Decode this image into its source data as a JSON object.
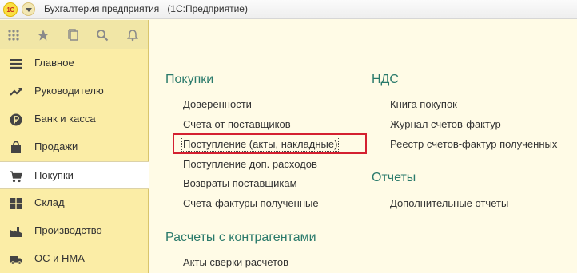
{
  "window": {
    "app_title": "Бухгалтерия предприятия",
    "platform_title": "(1С:Предприятие)",
    "logo_text": "1С"
  },
  "toolbar": {
    "icons": [
      "apps-grid-icon",
      "favorites-star-icon",
      "history-icon",
      "search-icon",
      "notifications-bell-icon"
    ]
  },
  "sidebar": {
    "items": [
      {
        "label": "Главное",
        "icon": "menu-lines-icon"
      },
      {
        "label": "Руководителю",
        "icon": "trend-icon"
      },
      {
        "label": "Банк и касса",
        "icon": "ruble-coin-icon"
      },
      {
        "label": "Продажи",
        "icon": "shopping-bag-icon"
      },
      {
        "label": "Покупки",
        "icon": "shopping-cart-icon",
        "active": true
      },
      {
        "label": "Склад",
        "icon": "warehouse-grid-icon"
      },
      {
        "label": "Производство",
        "icon": "factory-icon"
      },
      {
        "label": "ОС и НМА",
        "icon": "truck-icon"
      }
    ]
  },
  "main": {
    "sections": {
      "purchases": {
        "title": "Покупки",
        "links": [
          "Доверенности",
          "Счета от поставщиков",
          "Поступление (акты, накладные)",
          "Поступление доп. расходов",
          "Возвраты поставщикам",
          "Счета-фактуры полученные"
        ]
      },
      "vat": {
        "title": "НДС",
        "links": [
          "Книга покупок",
          "Журнал счетов-фактур",
          "Реестр счетов-фактур полученных"
        ]
      },
      "reports": {
        "title": "Отчеты",
        "links": [
          "Дополнительные отчеты"
        ]
      },
      "settlements": {
        "title": "Расчеты с контрагентами",
        "links": [
          "Акты сверки расчетов"
        ]
      }
    },
    "highlighted_link": "Поступление (акты, накладные)"
  },
  "colors": {
    "sidebar_bg": "#fbeda6",
    "content_bg": "#fffbe6",
    "section_title": "#2a7a6b",
    "highlight_border": "#d42030"
  }
}
